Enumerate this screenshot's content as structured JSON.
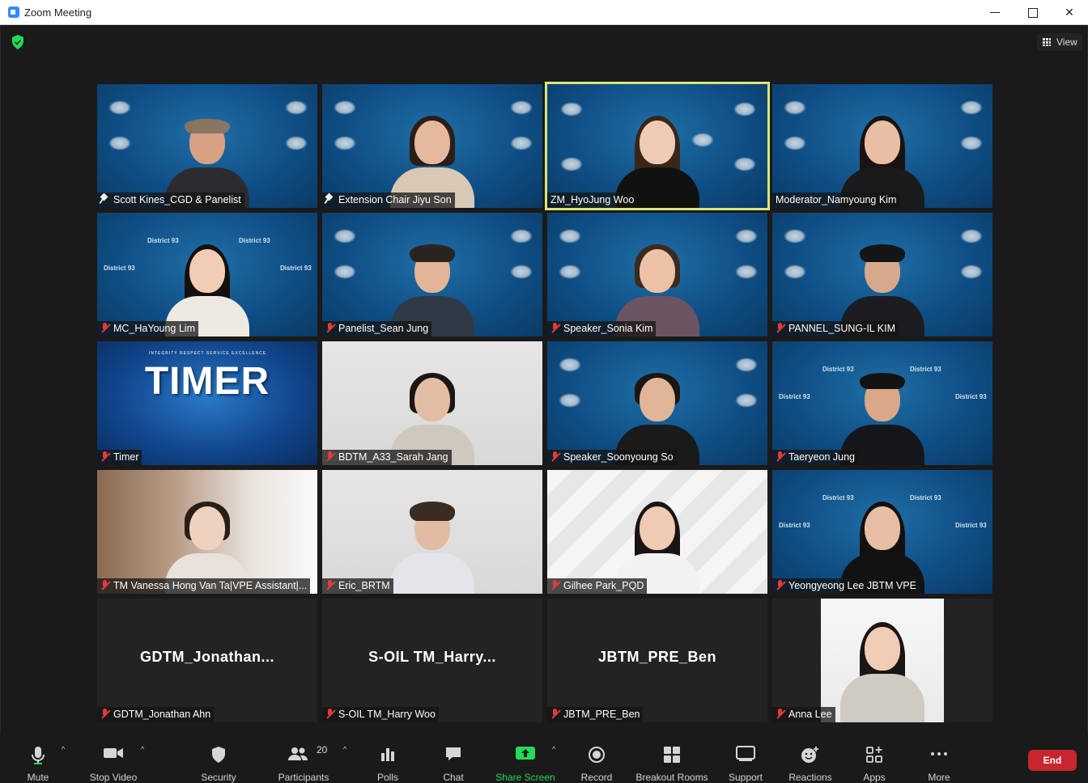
{
  "window": {
    "title": "Zoom Meeting"
  },
  "header": {
    "view_label": "View"
  },
  "tiles": [
    {
      "name": "Scott Kines_CGD & Panelist",
      "icon": "pin"
    },
    {
      "name": "Extension Chair Jiyu Son",
      "icon": "pin"
    },
    {
      "name": "ZM_HyoJung Woo",
      "icon": "none",
      "active": true
    },
    {
      "name": "Moderator_Namyoung Kim",
      "icon": "none"
    },
    {
      "name": "MC_HaYoung Lim",
      "icon": "muted"
    },
    {
      "name": "Panelist_Sean Jung",
      "icon": "muted"
    },
    {
      "name": "Speaker_Sonia Kim",
      "icon": "muted"
    },
    {
      "name": "PANNEL_SUNG-IL KIM",
      "icon": "muted"
    },
    {
      "name": "Timer",
      "icon": "muted",
      "banner": "TIMER",
      "strip": "INTEGRITY   RESPECT   SERVICE   EXCELLENCE"
    },
    {
      "name": "BDTM_A33_Sarah Jang",
      "icon": "muted"
    },
    {
      "name": "Speaker_Soonyoung So",
      "icon": "muted"
    },
    {
      "name": "Taeryeon Jung",
      "icon": "muted"
    },
    {
      "name": "TM Vanessa Hong Van Ta|VPE Assistant|...",
      "icon": "muted"
    },
    {
      "name": "Eric_BRTM",
      "icon": "muted"
    },
    {
      "name": "Gilhee Park_PQD",
      "icon": "muted"
    },
    {
      "name": "Yeongyeong Lee JBTM VPE",
      "icon": "muted"
    },
    {
      "name": "GDTM_Jonathan Ahn",
      "icon": "muted",
      "display_name": "GDTM_Jonathan..."
    },
    {
      "name": "S-OIL TM_Harry Woo",
      "icon": "muted",
      "display_name": "S-OIL  TM_Harry..."
    },
    {
      "name": "JBTM_PRE_Ben",
      "icon": "muted",
      "display_name": "JBTM_PRE_Ben"
    },
    {
      "name": "Anna Lee",
      "icon": "muted"
    }
  ],
  "toolbar": {
    "mute": "Mute",
    "stop_video": "Stop Video",
    "security": "Security",
    "participants": "Participants",
    "participants_count": "20",
    "polls": "Polls",
    "chat": "Chat",
    "share_screen": "Share Screen",
    "record": "Record",
    "breakout_rooms": "Breakout Rooms",
    "support": "Support",
    "reactions": "Reactions",
    "apps": "Apps",
    "more": "More",
    "end": "End"
  },
  "colors": {
    "share_green": "#23d959",
    "end_red": "#c7262e",
    "active_speaker": "#d8e67a",
    "muted_red": "#e63a3a"
  }
}
